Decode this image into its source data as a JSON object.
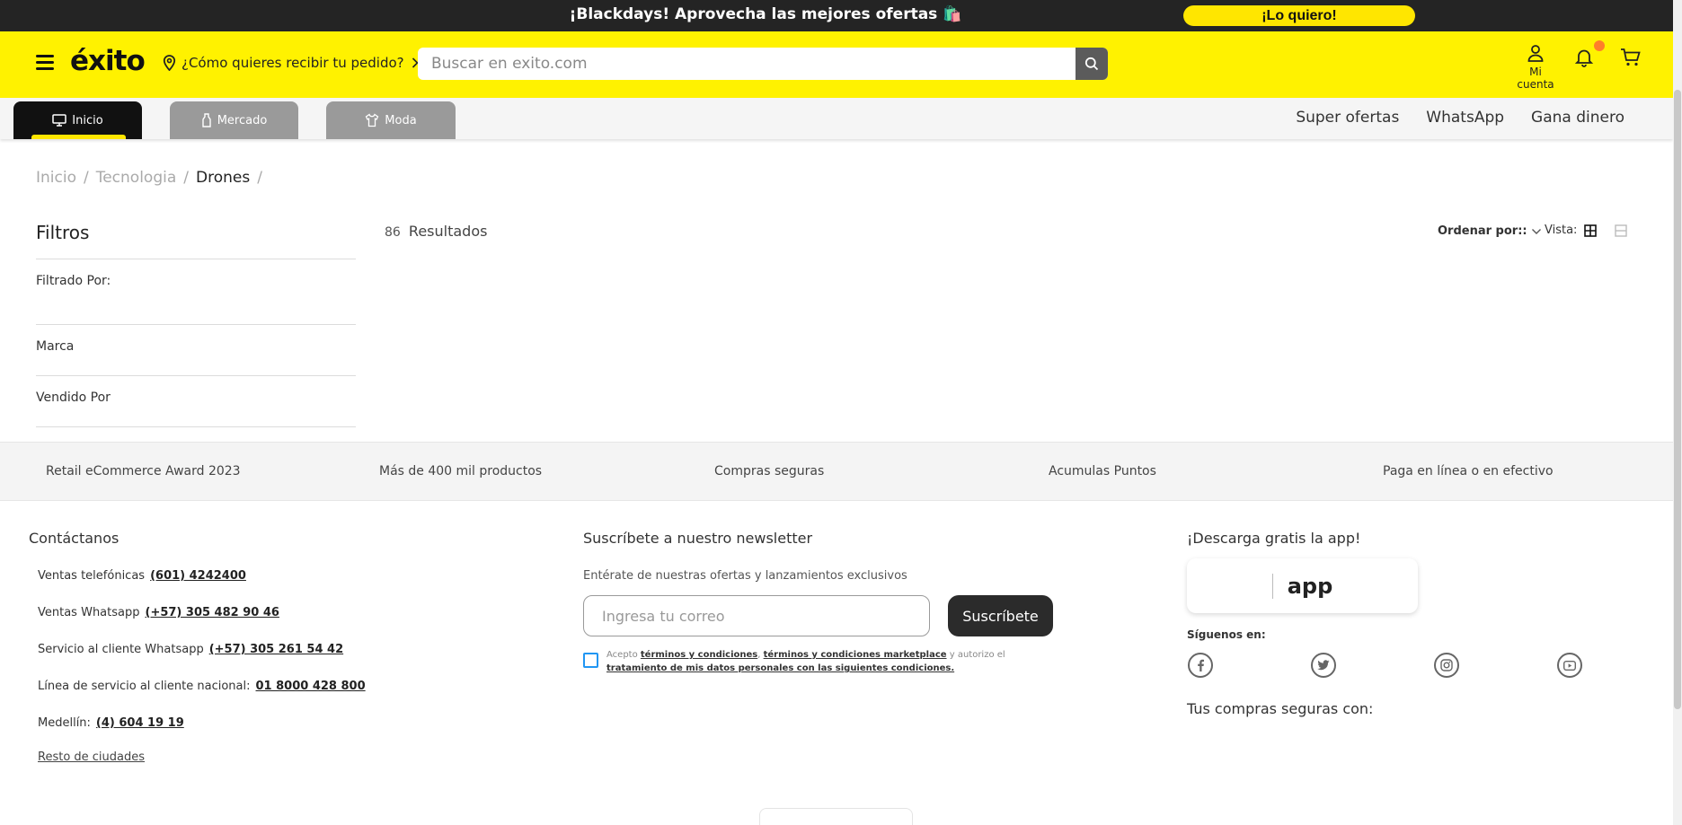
{
  "promo": {
    "text": "¡Blackdays! Aprovecha las mejores ofertas 🛍️",
    "cta": "¡Lo quiero!"
  },
  "header": {
    "logo": "éxito",
    "delivery": "¿Cómo quieres recibir tu pedido?",
    "search_placeholder": "Buscar en exito.com",
    "account_label": "Mi cuenta"
  },
  "tabs": [
    {
      "label": "Inicio",
      "active": true
    },
    {
      "label": "Mercado",
      "active": false
    },
    {
      "label": "Moda",
      "active": false
    }
  ],
  "top_links": [
    "Super ofertas",
    "WhatsApp",
    "Gana dinero"
  ],
  "breadcrumb": {
    "items": [
      "Inicio",
      "Tecnologia",
      "Drones"
    ],
    "separator": "/"
  },
  "filters": {
    "title": "Filtros",
    "filtered_by": "Filtrado Por:",
    "groups": [
      "Marca",
      "Vendido Por"
    ]
  },
  "results": {
    "count": "86",
    "label": "Resultados",
    "sort_label": "Ordenar por::",
    "view_label": "Vista:"
  },
  "benefits": [
    "Retail eCommerce Award 2023",
    "Más de 400 mil productos",
    "Compras seguras",
    "Acumulas Puntos",
    "Paga en línea o en efectivo"
  ],
  "footer": {
    "contact": {
      "title": "Contáctanos",
      "rows": [
        {
          "label": "Ventas telefónicas",
          "value": "(601) 4242400"
        },
        {
          "label": "Ventas Whatsapp",
          "value": "(+57) 305 482 90 46"
        },
        {
          "label": "Servicio al cliente Whatsapp",
          "value": "(+57) 305 261 54 42"
        },
        {
          "label": "Línea de servicio al cliente nacional:",
          "value": "01 8000 428 800"
        },
        {
          "label": "Medellín:",
          "value": "(4) 604 19 19"
        }
      ],
      "more": "Resto de ciudades"
    },
    "newsletter": {
      "title": "Suscríbete a nuestro newsletter",
      "subtitle": "Entérate de nuestras ofertas y lanzamientos exclusivos",
      "placeholder": "Ingresa tu correo",
      "button": "Suscríbete",
      "terms_prefix": "Acepto",
      "terms_link1": "términos y condiciones",
      "terms_link2": "términos y condiciones marketplace",
      "terms_mid": "y autorizo el",
      "terms_link3": "tratamiento de mis datos personales con las siguientes condiciones."
    },
    "app": {
      "title": "¡Descarga gratis la app!",
      "badge": "app",
      "follow": "Síguenos en:",
      "social_icons": [
        "facebook-icon",
        "twitter-icon",
        "instagram-icon",
        "youtube-icon"
      ],
      "secure": "Tus compras seguras con:"
    }
  },
  "colors": {
    "brand_yellow": "#fff200",
    "dark": "#242424",
    "tab_inactive": "#9a9a9a",
    "checkbox_blue": "#2196f3"
  }
}
